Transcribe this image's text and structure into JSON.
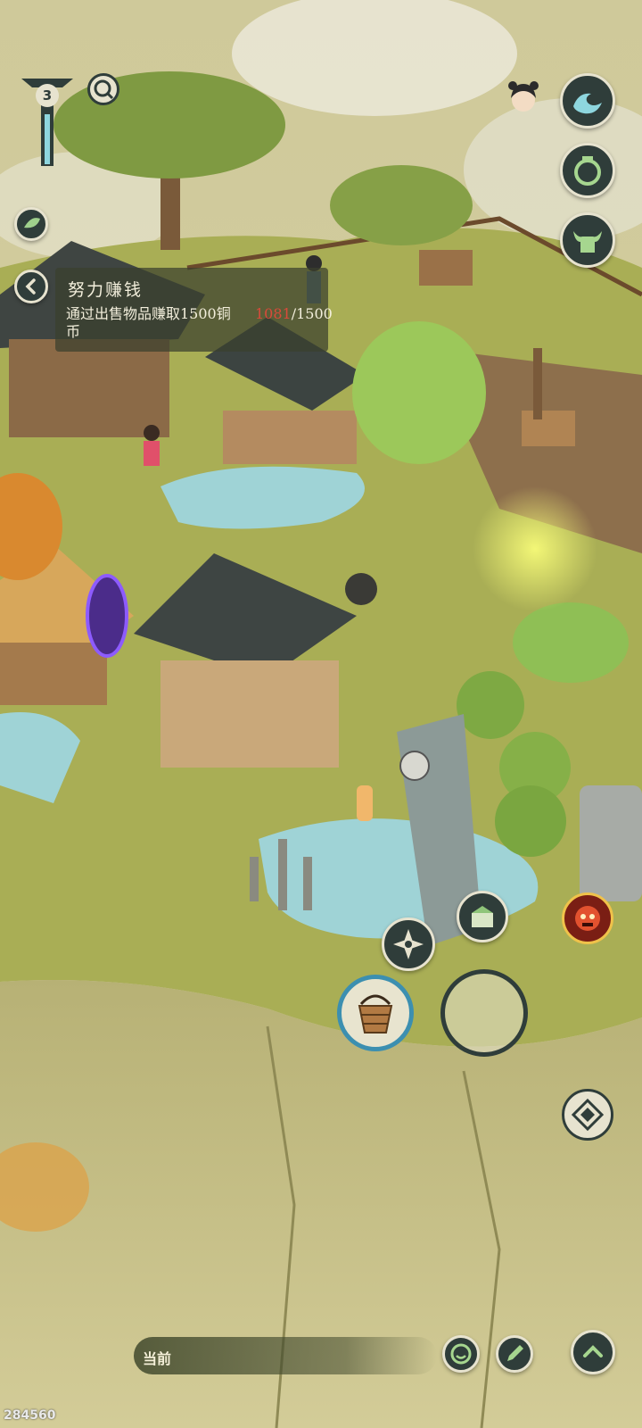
{
  "quest": {
    "title": "努力赚钱",
    "description": "通过出售物品赚取1500铜币",
    "progress_current": "1081",
    "progress_total": "/1500"
  },
  "level_badge": {
    "value": "3"
  },
  "bottom_bar": {
    "label": "当前"
  },
  "player_id": "284560",
  "icons": {
    "search": "search-icon",
    "leaf_button": "leaf-icon",
    "back_button": "chevron-left-icon",
    "wave_button": "wave-icon",
    "pot_button": "pot-icon",
    "ox_button": "ox-icon",
    "bucket_tool": "bucket-icon",
    "compass_button": "compass-icon",
    "gift_button": "gift-box-icon",
    "demon_button": "demon-face-icon",
    "diamond_button": "diamond-icon",
    "emote_button": "smile-icon",
    "edit_button": "pencil-icon",
    "expand_button": "chevron-up-icon"
  },
  "colors": {
    "panel_bg": "#3a402e",
    "progress_current": "#d94a3a",
    "button_dark": "#2f3d3a",
    "button_rim": "#e7e3cf",
    "water": "#9fd3d6",
    "grass": "#a6ad52"
  }
}
